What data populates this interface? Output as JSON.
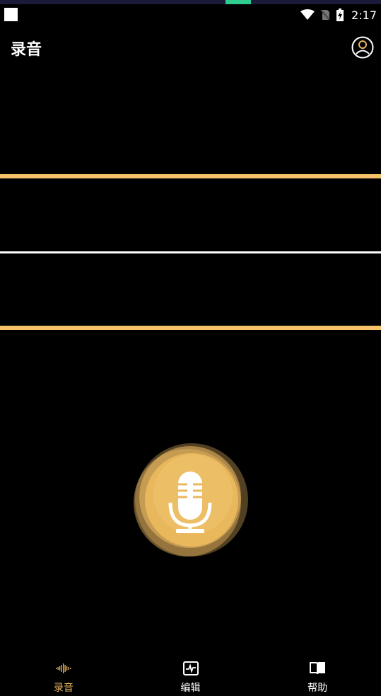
{
  "status_bar": {
    "time": "2:17"
  },
  "app_bar": {
    "title": "录音"
  },
  "bottom_nav": {
    "items": [
      {
        "label": "录音",
        "active": true,
        "icon": "waveform-icon"
      },
      {
        "label": "编辑",
        "active": false,
        "icon": "pulse-chart-icon"
      },
      {
        "label": "帮助",
        "active": false,
        "icon": "book-icon"
      }
    ]
  },
  "colors": {
    "accent": "#e8b660",
    "line_gold": "#f7c26a",
    "background": "#000000"
  }
}
